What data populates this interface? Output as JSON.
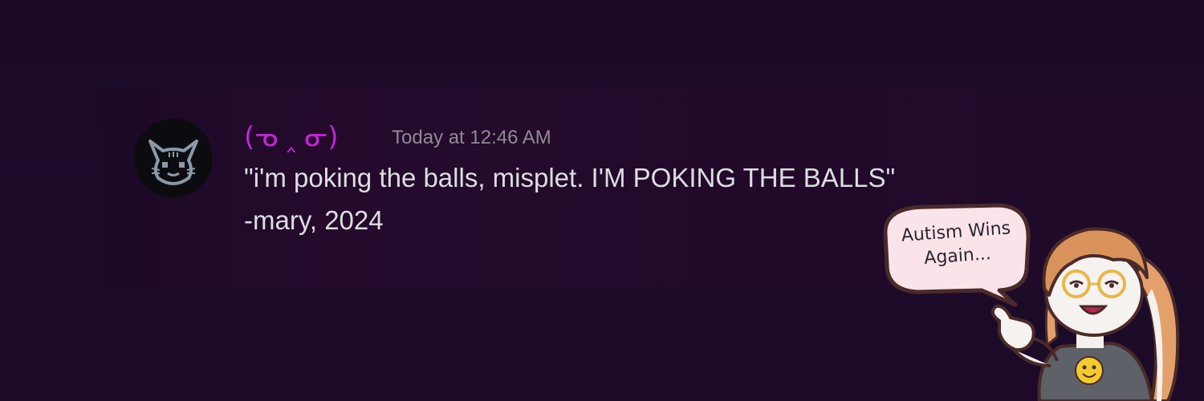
{
  "message": {
    "username": "(ᓀ ‸ ᓂ)",
    "timestamp": "Today at 12:46 AM",
    "lines": [
      "\"i'm poking the balls, misplet. I'M POKING THE BALLS\"",
      "-mary, 2024"
    ]
  },
  "sticker": {
    "bubble_lines": [
      "Autism Wins",
      "Again..."
    ]
  },
  "colors": {
    "background": "#1c0a28",
    "username": "#c026d3",
    "timestamp": "#8f8b96",
    "message_text": "#dcdde1"
  },
  "icons": {
    "avatar": "cat-avatar-icon",
    "sticker": "bunny-character-illustration"
  }
}
